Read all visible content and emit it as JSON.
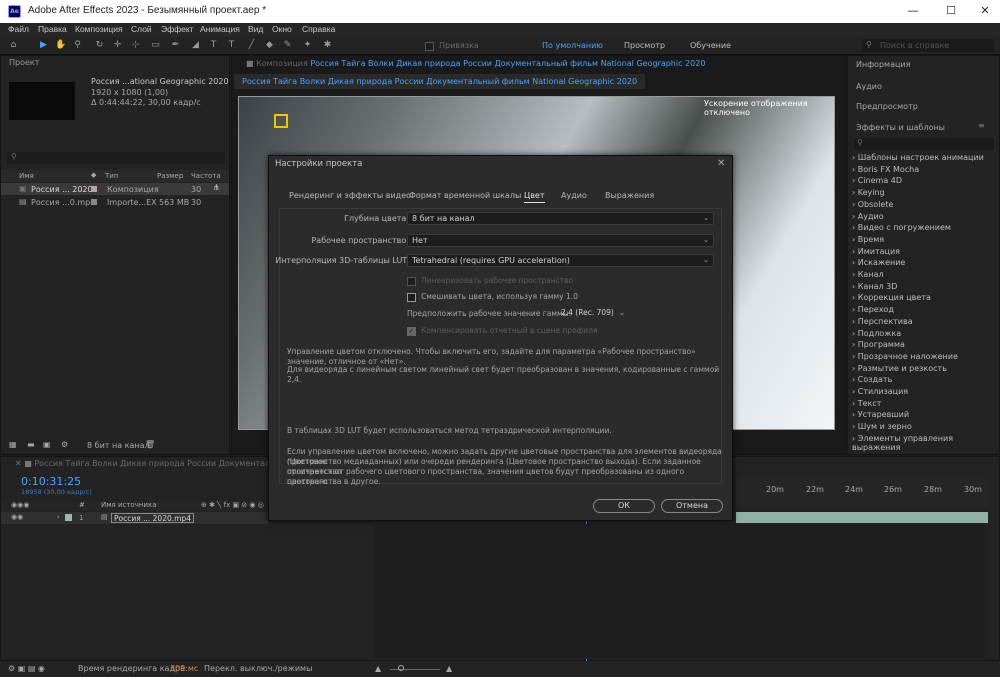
{
  "app": {
    "title": "Adobe After Effects 2023 - Безымянный проект.aep *",
    "icon_text": "Ae"
  },
  "menu": [
    "Файл",
    "Правка",
    "Композиция",
    "Слой",
    "Эффект",
    "Анимация",
    "Вид",
    "Окно",
    "Справка"
  ],
  "toolbar": {
    "workspaces": [
      "По умолчанию",
      "Просмотр",
      "Обучение"
    ],
    "snap_label": "Привязка",
    "search_placeholder": "Поиск в справке"
  },
  "project": {
    "tab": "Проект",
    "comp_name": "Россия ...ational Geographic 2020",
    "comp_size": "1920 x 1080 (1,00)",
    "comp_duration": "Δ 0:44:44:22, 30,00 кадр/с",
    "columns": [
      "Имя",
      "Тип",
      "Размер",
      "Частота ..."
    ],
    "items": [
      {
        "name": "Россия ... 2020",
        "type": "Композиция",
        "size": "",
        "fps": "30"
      },
      {
        "name": "Россия ...0.mp4",
        "type": "Importe...EX",
        "size": "563 MB",
        "fps": "30"
      }
    ],
    "bit_depth": "8 бит на канал"
  },
  "comp_panel": {
    "breadcrumb_prefix": "Композиция",
    "comp_title": "Россия Тайга Волки Дикая природа России Документальный фильм National Geographic 2020",
    "tab_title": "Россия Тайга Волки Дикая природа России Документальный фильм National Geographic 2020",
    "viewer_overlay": "Ускорение отображения отключено"
  },
  "timeline": {
    "tab": "Россия Тайга Волки Дикая природа России Документальный фильм National Geographic 2020",
    "timecode": "0:10:31:25",
    "frame_info": "18958 (30,00 кадр/с)",
    "col_source": "Имя источника",
    "layer": {
      "index": "1",
      "name": "Россия ... 2020.mp4"
    },
    "ruler": [
      "20m",
      "22m",
      "24m",
      "26m",
      "28m",
      "30m"
    ],
    "render_time_label": "Время рендеринга кадра:",
    "render_time_value": "300 мс",
    "toggle_modes": "Перекл. выключ./режимы"
  },
  "right_panels": {
    "info": "Информация",
    "audio": "Аудио",
    "preview": "Предпросмотр",
    "effects": "Эффекты и шаблоны",
    "effects_list": [
      "Шаблоны настроек анимации",
      "Boris FX Mocha",
      "Cinema 4D",
      "Keying",
      "Obsolete",
      "Аудио",
      "Видео с погружением",
      "Время",
      "Имитация",
      "Искажение",
      "Канал",
      "Канал 3D",
      "Коррекция цвета",
      "Переход",
      "Перспектива",
      "Подложка",
      "Программа",
      "Прозрачное наложение",
      "Размытие и резкость",
      "Создать",
      "Стилизация",
      "Текст",
      "Устаревший",
      "Шум и зерно",
      "Элементы управления выражения"
    ]
  },
  "dialog": {
    "title": "Настройки проекта",
    "tabs": [
      "Рендеринг и эффекты видео",
      "Формат временной шкалы",
      "Цвет",
      "Аудио",
      "Выражения"
    ],
    "active_tab": "Цвет",
    "bit_depth_label": "Глубина цвета:",
    "bit_depth_value": "8 бит на канал",
    "workspace_label": "Рабочее пространство:",
    "workspace_value": "Нет",
    "lut_label": "Интерполяция 3D-таблицы LUT:",
    "lut_value": "Tetrahedral (requires GPU acceleration)",
    "linearize_label": "Линеаризовать рабочее пространство",
    "blend_gamma_label": "Смешивать цвета, используя гамму 1.0",
    "gamma_label": "Предположить рабочее значение гаммы:",
    "gamma_value": "2.4 (Rec. 709)",
    "compensate_label": "Компенсировать отчетный в сцене профиля",
    "info1": "Управление цветом отключено. Чтобы включить его, задайте для параметра «Рабочее пространство» значение, отличное от «Нет».",
    "info2": "Для видеоряда с линейным светом линейный свет будет преобразован в значения, кодированные с гаммой 2,4.",
    "info3": "В таблицах 3D LUT будет использоваться метод тетраэдрической интерполяции.",
    "info4_l1": "Если управление цветом включено, можно задать другие цветовые пространства для элементов видеоряда (Цветовое",
    "info4_l2": "пространство медиаданных) или очереди рендеринга (Цветовое пространство выхода). Если заданное пространство",
    "info4_l3": "отличается от рабочего цветового пространства, значения цветов будут преобразованы из одного цветового",
    "info4_l4": "пространства в другое.",
    "ok": "ОК",
    "cancel": "Отмена"
  }
}
